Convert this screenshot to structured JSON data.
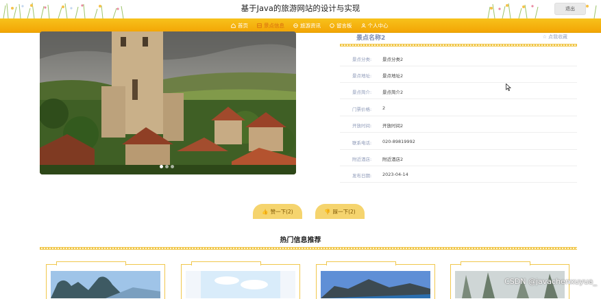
{
  "header": {
    "title": "基于Java的旅游网站的设计与实现",
    "logout_label": "退出"
  },
  "nav": {
    "items": [
      {
        "label": "首页",
        "icon": "home-icon"
      },
      {
        "label": "景点信息",
        "icon": "scenic-icon"
      },
      {
        "label": "旅游资讯",
        "icon": "news-icon"
      },
      {
        "label": "留言板",
        "icon": "message-icon"
      },
      {
        "label": "个人中心",
        "icon": "user-icon"
      }
    ],
    "active_index": 1
  },
  "detail": {
    "name": "景点名称2",
    "favorite_label": "点我收藏",
    "fields": [
      {
        "key": "景点分类:",
        "value": "景点分类2"
      },
      {
        "key": "景点地址:",
        "value": "景点地址2"
      },
      {
        "key": "景点简介:",
        "value": "景点简介2"
      },
      {
        "key": "门票价格:",
        "value": "2"
      },
      {
        "key": "开放时间:",
        "value": "开放时间2"
      },
      {
        "key": "联系电话:",
        "value": "020-89819992"
      },
      {
        "key": "附近酒店:",
        "value": "附近酒店2"
      },
      {
        "key": "发布日期:",
        "value": "2023-04-14"
      }
    ]
  },
  "votes": {
    "up_label": "赞一下(2)",
    "down_label": "踩一下(2)"
  },
  "hot": {
    "title": "热门信息推荐"
  },
  "watermark": "CSDN @javachenxuyua_",
  "colors": {
    "nav_bg": "#f5b310",
    "accent": "#f0c64a",
    "active_nav": "#d86b10",
    "label": "#8e9ab8"
  }
}
